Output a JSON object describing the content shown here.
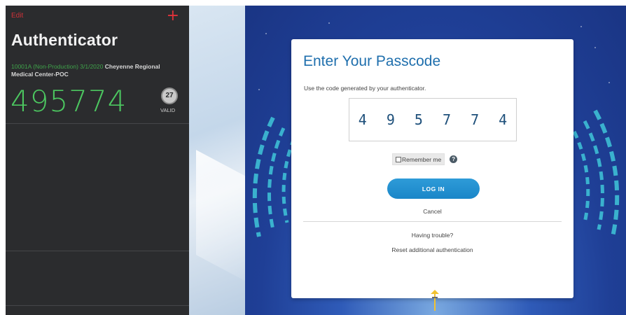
{
  "authenticator": {
    "edit_label": "Edit",
    "add_icon": "plus-icon",
    "title": "Authenticator",
    "account": {
      "id_text": "10001A (Non-Production) 3/1/2020",
      "name_text": "Cheyenne Regional Medical Center-POC"
    },
    "code": "495774",
    "seconds_remaining": "27",
    "status": "VALID",
    "colors": {
      "code": "#4cc760",
      "accent": "#e0323a",
      "background": "#2b2c2e"
    }
  },
  "login": {
    "title": "Enter Your Passcode",
    "instruction": "Use the code generated by your authenticator.",
    "passcode_value": "4 9 5 7 7 4",
    "remember_label": "Remember me",
    "help_icon": "question-icon",
    "login_button": "LOG IN",
    "cancel_label": "Cancel",
    "trouble_label": "Having trouble?",
    "reset_label": "Reset additional authentication",
    "colors": {
      "title": "#1f6fad",
      "button": "#1a86c8",
      "background": "#1f3f96"
    }
  }
}
